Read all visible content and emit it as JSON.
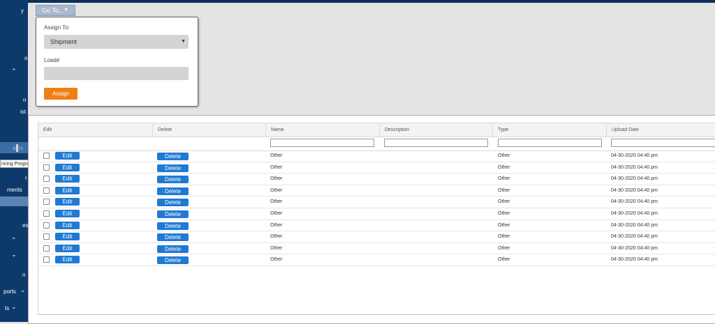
{
  "sidebar": {
    "fragments": [
      "y",
      "o",
      "n",
      "ist",
      "ams",
      "r",
      "ments",
      "es",
      "n",
      "ports",
      "ts"
    ]
  },
  "tooltip": {
    "text": "ricing Programs"
  },
  "goto": {
    "label": "Go To..."
  },
  "popup": {
    "assign_to_label": "Assign To:",
    "assign_to_value": "Shipment",
    "load_label": "Load#",
    "load_value": "",
    "assign_button": "Assign"
  },
  "table": {
    "columns": [
      "Edit",
      "Delete",
      "Name",
      "Description",
      "Type",
      "Upload Date"
    ],
    "edit_label": "Edit",
    "delete_label": "Delete",
    "rows": [
      {
        "name": "Other",
        "description": "",
        "type": "Other",
        "upload_date": "04-30-2020 04:40 pm"
      },
      {
        "name": "Other",
        "description": "",
        "type": "Other",
        "upload_date": "04-30-2020 04:40 pm"
      },
      {
        "name": "Other",
        "description": "",
        "type": "Other",
        "upload_date": "04-30-2020 04:40 pm"
      },
      {
        "name": "Other",
        "description": "",
        "type": "Other",
        "upload_date": "04-30-2020 04:40 pm"
      },
      {
        "name": "Other",
        "description": "",
        "type": "Other",
        "upload_date": "04-30-2020 04:40 pm"
      },
      {
        "name": "Other",
        "description": "",
        "type": "Other",
        "upload_date": "04-30-2020 04:40 pm"
      },
      {
        "name": "Other",
        "description": "",
        "type": "Other",
        "upload_date": "04-30-2020 04:40 pm"
      },
      {
        "name": "Other",
        "description": "",
        "type": "Other",
        "upload_date": "04-30-2020 04:40 pm"
      },
      {
        "name": "Other",
        "description": "",
        "type": "Other",
        "upload_date": "04-30-2020 04:40 pm"
      },
      {
        "name": "Other",
        "description": "",
        "type": "Other",
        "upload_date": "04-30-2020 04:40 pm"
      }
    ]
  }
}
